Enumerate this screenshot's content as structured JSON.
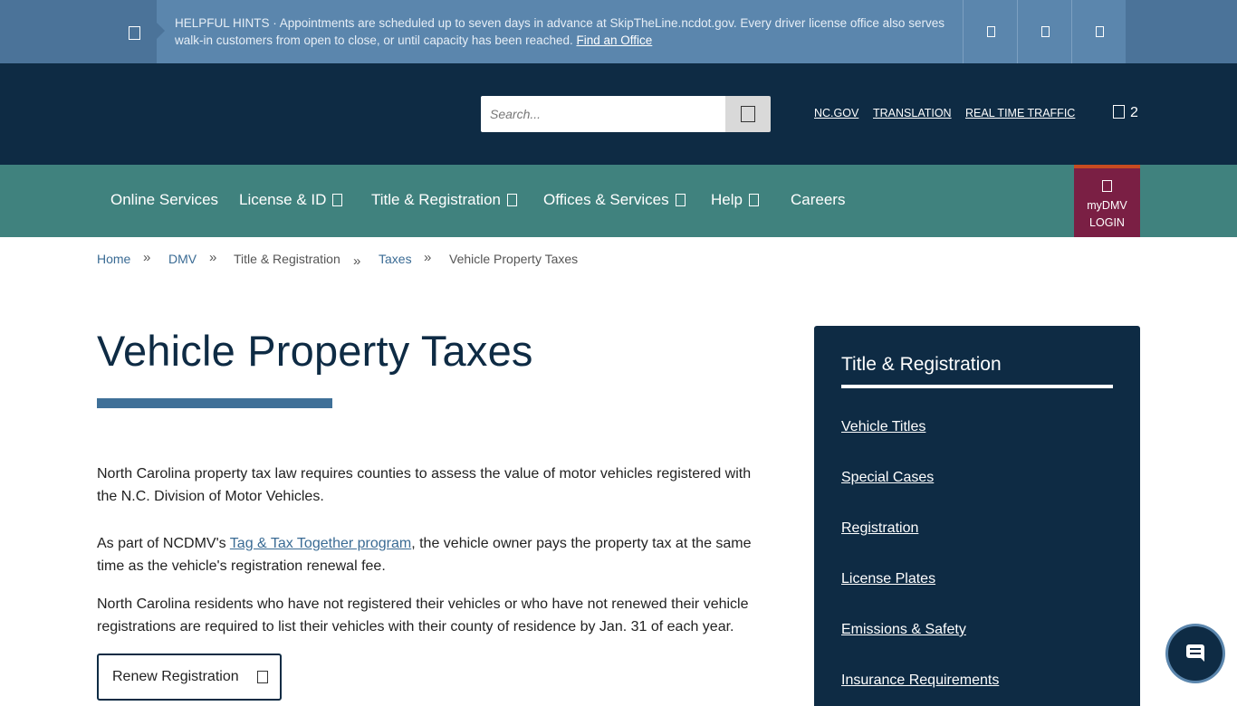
{
  "hints": {
    "label": "HELPFUL HINTS",
    "text": " · Appointments are scheduled up to seven days in advance at SkipTheLine.ncdot.gov. Every driver license office also serves walk-in customers from open to close, or until capacity has been reached. ",
    "link": "Find an Office",
    "icons": [
      "info-icon",
      "prev-icon",
      "pause-icon",
      "next-icon"
    ]
  },
  "search": {
    "placeholder": "Search...",
    "icon": "search-icon"
  },
  "top_links": [
    "NC.GOV",
    "TRANSLATION",
    "REAL TIME TRAFFIC"
  ],
  "cart": {
    "icon": "cart-icon",
    "count": "2"
  },
  "nav": {
    "items": [
      {
        "label": "Online Services",
        "dropdown": false
      },
      {
        "label": "License & ID",
        "dropdown": true
      },
      {
        "label": "Title & Registration",
        "dropdown": true
      },
      {
        "label": "Offices & Services",
        "dropdown": true
      },
      {
        "label": "Help",
        "dropdown": true
      },
      {
        "label": "Careers",
        "dropdown": false
      }
    ],
    "mydmv": {
      "line1": "myDMV",
      "line2": "LOGIN",
      "icon": "user-icon"
    }
  },
  "breadcrumb": [
    {
      "label": "Home",
      "link": true
    },
    {
      "label": "DMV",
      "link": true
    },
    {
      "label": "Title & Registration",
      "link": false
    },
    {
      "label": "Taxes",
      "link": true
    },
    {
      "label": "Vehicle Property Taxes",
      "link": false
    }
  ],
  "breadcrumb_sep": "»",
  "page": {
    "title": "Vehicle Property Taxes",
    "p1": "North Carolina property tax law requires counties to assess the value of motor vehicles registered with the N.C. Division of Motor Vehicles.",
    "p2_before": "As part of NCDMV's ",
    "p2_link": "Tag & Tax Together program",
    "p2_after": ", the vehicle owner pays the property tax at the same time as the vehicle's registration renewal fee.",
    "p3": "North Carolina residents who have not registered their vehicles or who have not renewed their vehicle registrations are required to list their vehicles with their county of residence by Jan. 31 of each year.",
    "renew_label": "Renew Registration"
  },
  "sidebar": {
    "title": "Title & Registration",
    "links": [
      "Vehicle Titles",
      "Special Cases",
      "Registration",
      "License Plates",
      "Emissions & Safety",
      "Insurance Requirements"
    ]
  },
  "colors": {
    "header": "#0e2b44",
    "nav": "#40827e",
    "hint": "#5b86ad",
    "mydmv": "#7a1f44",
    "accent_bar": "#3f7098"
  }
}
